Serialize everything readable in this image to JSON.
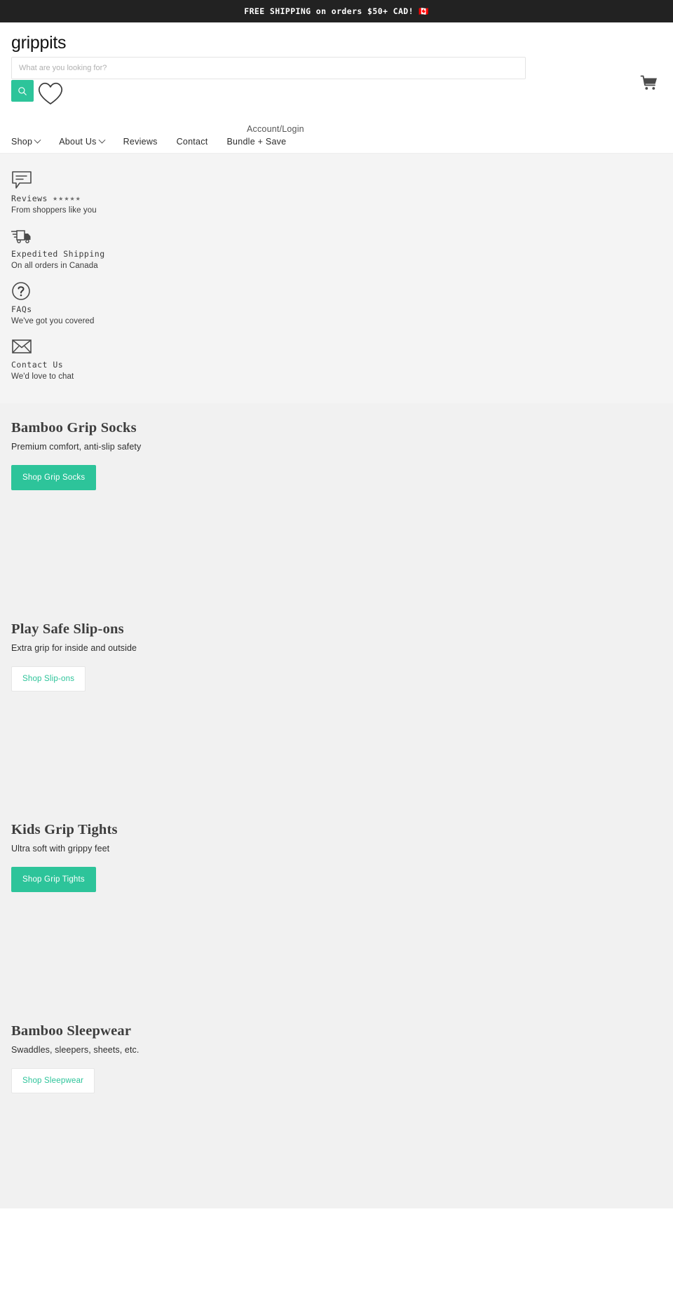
{
  "announcement": {
    "text": "FREE SHIPPING on orders $50+ CAD!",
    "flag": "🇨🇦"
  },
  "header": {
    "logo": "grippits",
    "search": {
      "placeholder": "What are you looking for?",
      "value": "",
      "button_label": "Search"
    },
    "account_label": "Account/Login",
    "cart_label": "Cart",
    "wishlist_label": "Wishlist"
  },
  "nav": {
    "items": [
      {
        "label": "Shop",
        "has_caret": true
      },
      {
        "label": "About Us",
        "has_caret": true
      },
      {
        "label": "Reviews",
        "has_caret": false
      },
      {
        "label": "Contact",
        "has_caret": false
      },
      {
        "label": "Bundle + Save",
        "has_caret": false
      }
    ]
  },
  "value_props": [
    {
      "icon": "chat-bubble-icon",
      "title": "Reviews",
      "stars": "★★★★★",
      "subtitle": "From shoppers like you"
    },
    {
      "icon": "delivery-truck-icon",
      "title": "Expedited Shipping",
      "stars": "",
      "subtitle": "On all orders in Canada"
    },
    {
      "icon": "question-mark-icon",
      "title": "FAQs",
      "stars": "",
      "subtitle": "We've got you covered"
    },
    {
      "icon": "envelope-icon",
      "title": "Contact Us",
      "stars": "",
      "subtitle": "We'd love to chat"
    }
  ],
  "collections": [
    {
      "title": "Bamboo Grip Socks",
      "subtitle": "Premium comfort, anti-slip safety",
      "button": "Shop Grip Socks",
      "button_style": "solid"
    },
    {
      "title": "Play Safe Slip-ons",
      "subtitle": "Extra grip for inside and outside",
      "button": "Shop Slip-ons",
      "button_style": "ghost"
    },
    {
      "title": "Kids Grip Tights",
      "subtitle": "Ultra soft with grippy feet",
      "button": "Shop Grip Tights",
      "button_style": "solid"
    },
    {
      "title": "Bamboo Sleepwear",
      "subtitle": "Swaddles, sleepers, sheets, etc.",
      "button": "Shop Sleepwear",
      "button_style": "ghost"
    }
  ],
  "colors": {
    "accent": "#2dc49a",
    "banner_bg": "#222222",
    "band_bg": "#f4f4f4",
    "collection_bg": "#f1f1f1"
  }
}
